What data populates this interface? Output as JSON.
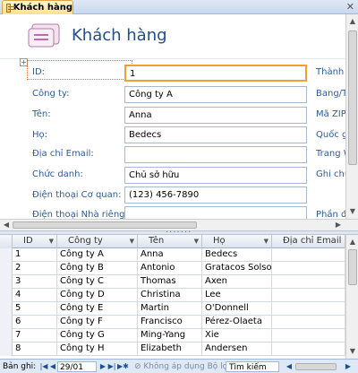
{
  "tab": {
    "title": "Khách hàng"
  },
  "form": {
    "title": "Khách hàng",
    "fields": [
      {
        "label": "ID:",
        "value": "1"
      },
      {
        "label": "Công ty:",
        "value": "Công ty A"
      },
      {
        "label": "Tên:",
        "value": "Anna"
      },
      {
        "label": "Họ:",
        "value": "Bedecs"
      },
      {
        "label": "Địa chỉ Email:",
        "value": ""
      },
      {
        "label": "Chức danh:",
        "value": "Chủ sở hữu"
      },
      {
        "label": "Điện thoại Cơ quan:",
        "value": "(123) 456-7890"
      },
      {
        "label": "Điện thoại Nhà riêng:",
        "value": ""
      }
    ],
    "right_labels": [
      "Thành p",
      "Bang/Tỉ",
      "Mã ZIP/",
      "Quốc gi",
      "Trang W",
      "Ghi chú",
      "Phần đí"
    ]
  },
  "datasheet": {
    "columns": [
      "ID",
      "Công ty",
      "Tên",
      "Họ",
      "Địa chỉ Email"
    ],
    "rows": [
      [
        "1",
        "Công ty A",
        "Anna",
        "Bedecs",
        ""
      ],
      [
        "2",
        "Công ty B",
        "Antonio",
        "Gratacos Solso",
        ""
      ],
      [
        "3",
        "Công ty C",
        "Thomas",
        "Axen",
        ""
      ],
      [
        "4",
        "Công ty D",
        "Christina",
        "Lee",
        ""
      ],
      [
        "5",
        "Công ty E",
        "Martin",
        "O'Donnell",
        ""
      ],
      [
        "6",
        "Công ty F",
        "Francisco",
        "Pérez-Olaeta",
        ""
      ],
      [
        "7",
        "Công ty G",
        "Ming-Yang",
        "Xie",
        ""
      ],
      [
        "8",
        "Công ty H",
        "Elizabeth",
        "Andersen",
        ""
      ]
    ]
  },
  "nav": {
    "record_label": "Bản ghi:",
    "current": "29/01",
    "filter_label": "Không áp dụng Bộ lọc",
    "search_label": "Tìm kiếm"
  },
  "colors": {
    "label_blue": "#2c5aa0",
    "title_blue": "#1f4e8c",
    "focus_orange": "#f0a030"
  }
}
